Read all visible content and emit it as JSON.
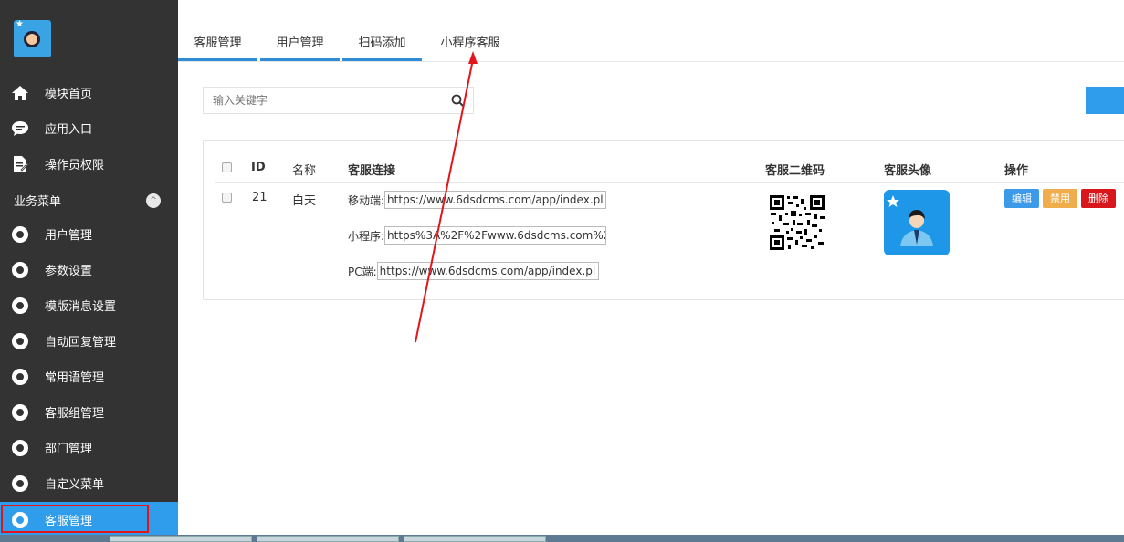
{
  "sidebar": {
    "items": [
      {
        "label": "模块首页",
        "icon": "home-icon"
      },
      {
        "label": "应用入口",
        "icon": "chat-bubble-icon"
      },
      {
        "label": "操作员权限",
        "icon": "edit-document-icon"
      }
    ],
    "section_title": "业务菜单",
    "section_toggle": "^",
    "menu": [
      {
        "label": "用户管理"
      },
      {
        "label": "参数设置"
      },
      {
        "label": "模版消息设置"
      },
      {
        "label": "自动回复管理"
      },
      {
        "label": "常用语管理"
      },
      {
        "label": "客服组管理"
      },
      {
        "label": "部门管理"
      },
      {
        "label": "自定义菜单"
      },
      {
        "label": "客服管理"
      }
    ]
  },
  "tabs": [
    {
      "label": "客服管理"
    },
    {
      "label": "用户管理"
    },
    {
      "label": "扫码添加"
    },
    {
      "label": "小程序客服"
    }
  ],
  "search": {
    "placeholder": "输入关键字"
  },
  "table": {
    "headers": {
      "id": "ID",
      "name": "名称",
      "link": "客服连接",
      "qr": "客服二维码",
      "avatar": "客服头像",
      "actions": "操作"
    },
    "rows": [
      {
        "id": "21",
        "name": "白天",
        "links": [
          {
            "label": "移动端:",
            "value": "https://www.6dsdcms.com/app/index.pl"
          },
          {
            "label": "小程序:",
            "value": "https%3A%2F%2Fwww.6dsdcms.com%2"
          },
          {
            "label": "PC端:",
            "value": "https://www.6dsdcms.com/app/index.pl"
          }
        ],
        "actions": {
          "edit": "编辑",
          "disable": "禁用",
          "delete": "删除"
        }
      }
    ]
  },
  "colors": {
    "sidebar_bg": "#333333",
    "accent": "#2f9dec",
    "edit": "#3d9ae8",
    "disable": "#f0ad4e",
    "delete": "#d9161c",
    "annotation": "#e4141b"
  }
}
